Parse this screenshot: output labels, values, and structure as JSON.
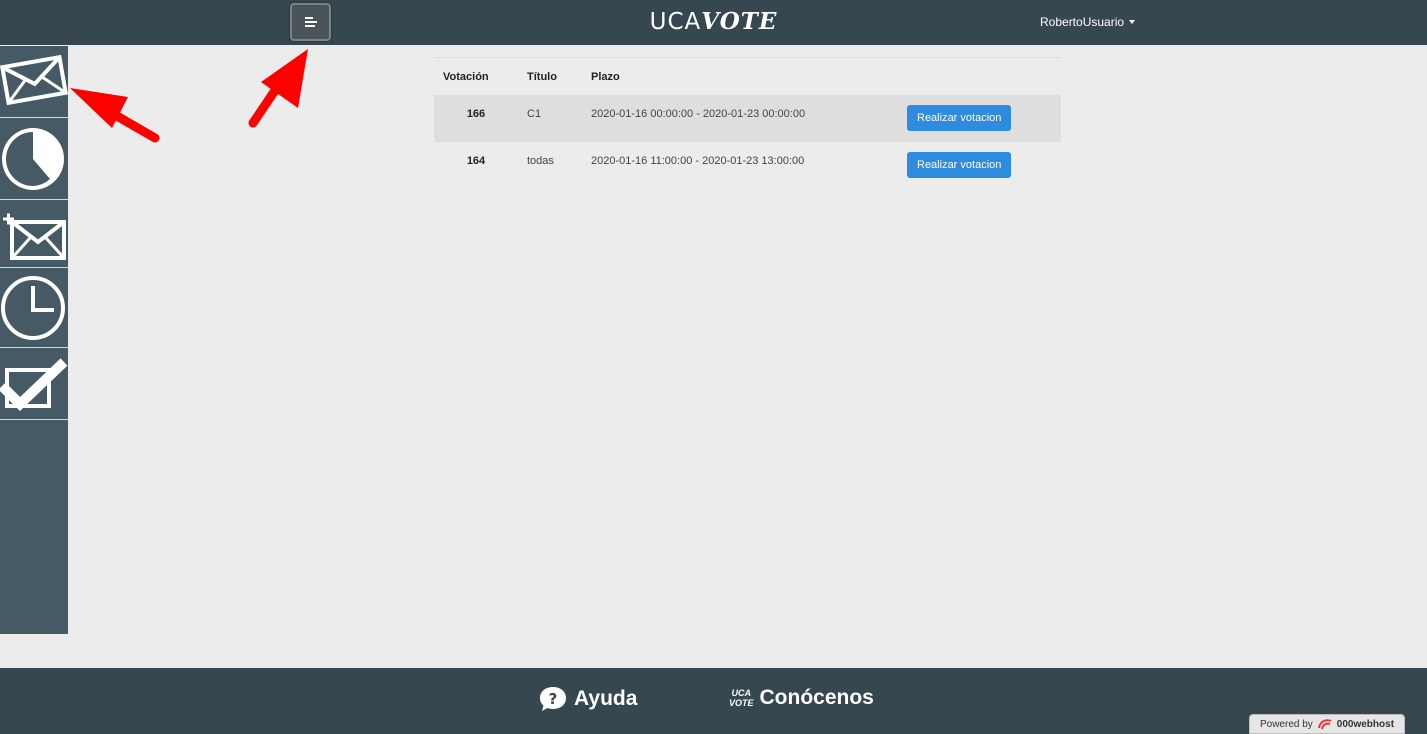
{
  "header": {
    "brand_uca": "UCA",
    "brand_vote": "VOTE",
    "user_name": "RobertoUsuario"
  },
  "sidebar": {
    "items": [
      {
        "icon": "envelope-icon"
      },
      {
        "icon": "pie-chart-icon"
      },
      {
        "icon": "add-envelope-icon"
      },
      {
        "icon": "clock-icon"
      },
      {
        "icon": "checkbox-icon"
      }
    ]
  },
  "table": {
    "headers": [
      "Votación",
      "Título",
      "Plazo"
    ],
    "rows": [
      {
        "id": "166",
        "title": "C1",
        "period": "2020-01-16 00:00:00 - 2020-01-23 00:00:00",
        "action": "Realizar votacion"
      },
      {
        "id": "164",
        "title": "todas",
        "period": "2020-01-16 11:00:00 - 2020-01-23 13:00:00",
        "action": "Realizar votacion"
      }
    ]
  },
  "footer": {
    "help_label": "Ayuda",
    "about_label": "Conócenos",
    "about_logo_top": "UCA",
    "about_logo_bottom": "VOTE",
    "powered_by": "Powered by",
    "host_name": "000webhost"
  },
  "colors": {
    "header_bg": "#37474f",
    "sidebar_bg": "#455a64",
    "button_bg": "#2e8bdd",
    "annotation_arrow": "#ff0000"
  }
}
